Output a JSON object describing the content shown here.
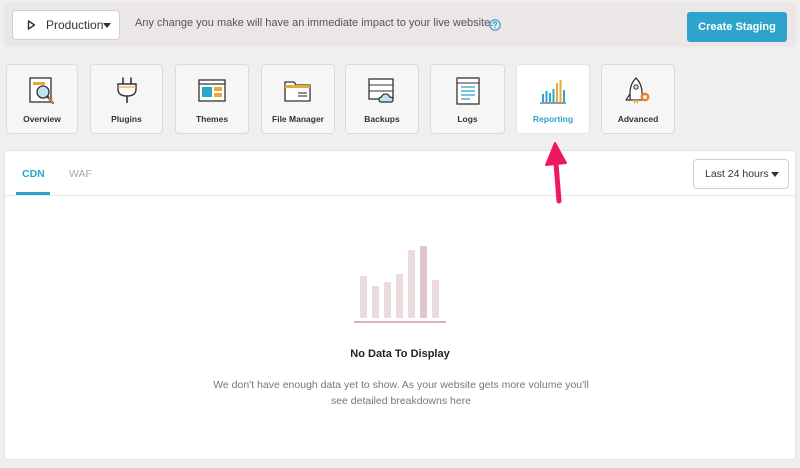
{
  "banner": {
    "environment": "Production",
    "message": "Any change you make will have an immediate impact to your live website.",
    "create_staging_label": "Create Staging"
  },
  "tools": [
    {
      "label": "Overview",
      "icon": "overview-icon"
    },
    {
      "label": "Plugins",
      "icon": "plugin-icon"
    },
    {
      "label": "Themes",
      "icon": "themes-icon"
    },
    {
      "label": "File Manager",
      "icon": "folder-icon"
    },
    {
      "label": "Backups",
      "icon": "backups-icon"
    },
    {
      "label": "Logs",
      "icon": "logs-icon"
    },
    {
      "label": "Reporting",
      "icon": "reporting-icon",
      "active": true
    },
    {
      "label": "Advanced",
      "icon": "rocket-icon"
    }
  ],
  "report": {
    "tabs": [
      "CDN",
      "WAF"
    ],
    "active_tab": "CDN",
    "range": "Last 24 hours",
    "empty_title": "No Data To Display",
    "empty_text": "We don't have enough data yet to show. As your website gets more volume you'll see detailed breakdowns here"
  },
  "colors": {
    "accent": "#2ea4cc",
    "arrow": "#f0185c",
    "banner_bg": "#ebe7e6"
  }
}
